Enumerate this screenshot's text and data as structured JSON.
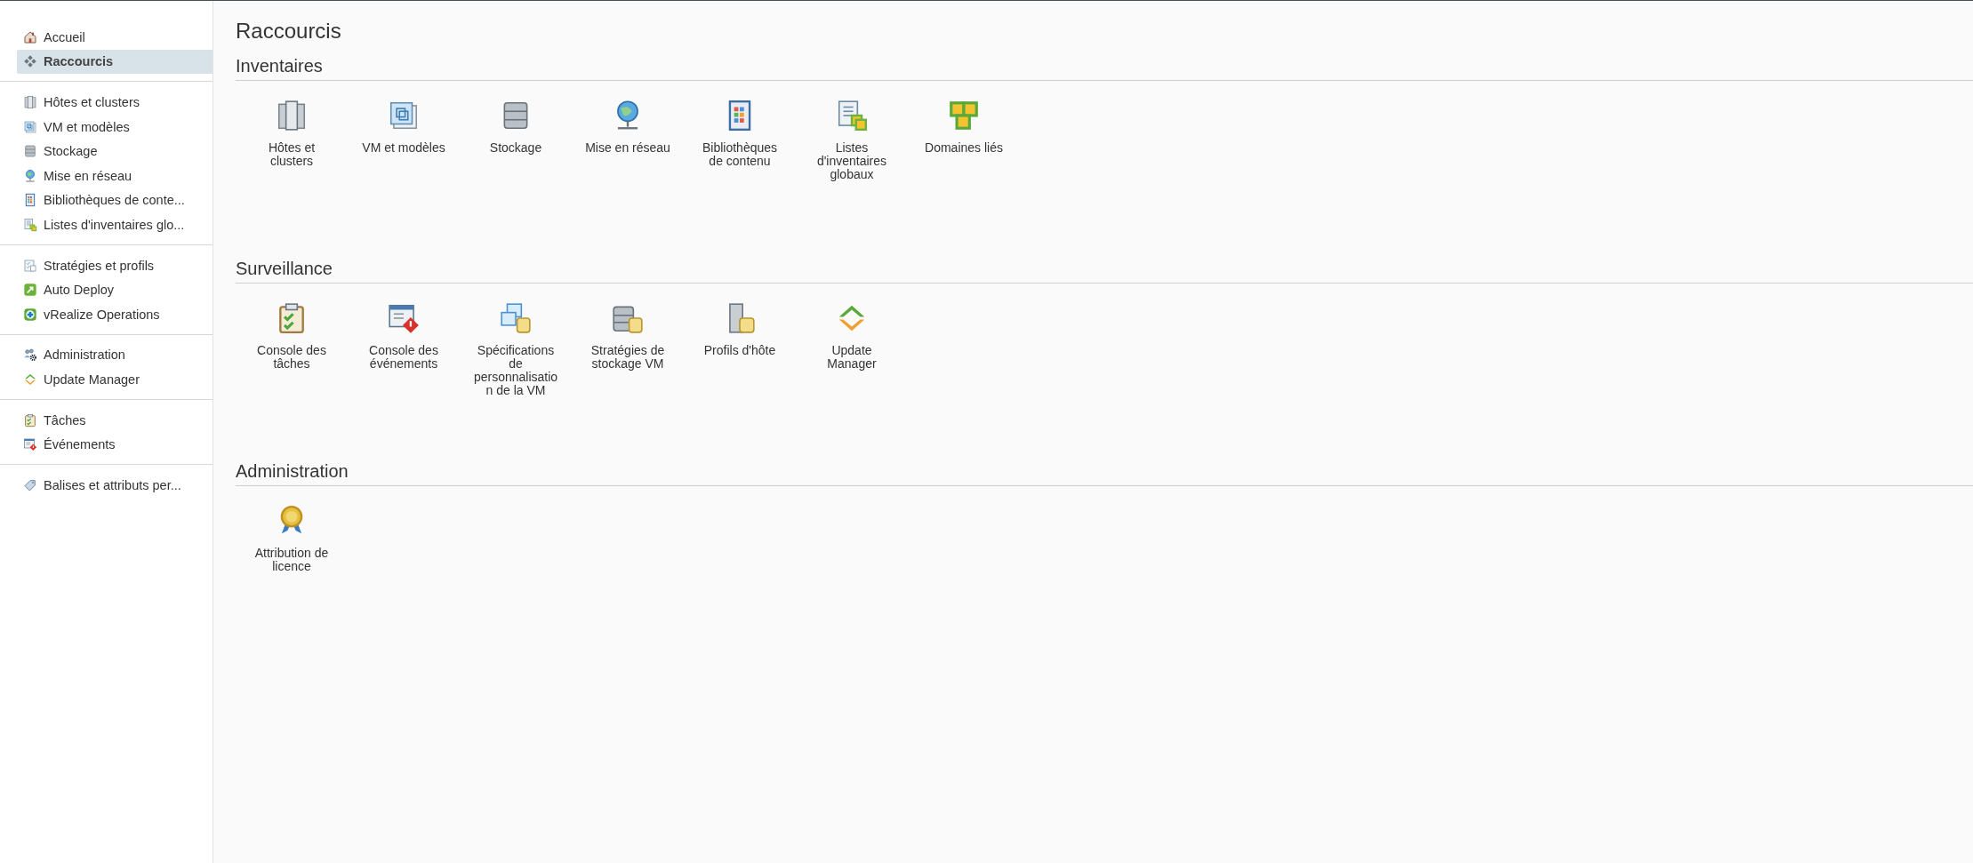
{
  "sidebar": {
    "groups": [
      [
        {
          "label": "Accueil",
          "kind": "home",
          "selected": false
        },
        {
          "label": "Raccourcis",
          "kind": "shortcuts",
          "selected": true
        }
      ],
      [
        {
          "label": "Hôtes et clusters",
          "kind": "hosts",
          "selected": false
        },
        {
          "label": "VM et modèles",
          "kind": "vms",
          "selected": false
        },
        {
          "label": "Stockage",
          "kind": "storage",
          "selected": false
        },
        {
          "label": "Mise en réseau",
          "kind": "network",
          "selected": false
        },
        {
          "label": "Bibliothèques de conte...",
          "kind": "library",
          "selected": false
        },
        {
          "label": "Listes d'inventaires glo...",
          "kind": "lists",
          "selected": false
        }
      ],
      [
        {
          "label": "Stratégies et profils",
          "kind": "policies",
          "selected": false
        },
        {
          "label": "Auto Deploy",
          "kind": "deploy",
          "selected": false
        },
        {
          "label": "vRealize Operations",
          "kind": "vrops",
          "selected": false
        }
      ],
      [
        {
          "label": "Administration",
          "kind": "admin",
          "selected": false
        },
        {
          "label": "Update Manager",
          "kind": "update",
          "selected": false
        }
      ],
      [
        {
          "label": "Tâches",
          "kind": "tasks",
          "selected": false
        },
        {
          "label": "Événements",
          "kind": "events",
          "selected": false
        }
      ],
      [
        {
          "label": "Balises et attributs per...",
          "kind": "tag",
          "selected": false
        }
      ]
    ]
  },
  "page": {
    "title": "Raccourcis",
    "sections": [
      {
        "heading": "Inventaires",
        "items": [
          {
            "label": "Hôtes et clusters",
            "kind": "hosts"
          },
          {
            "label": "VM et modèles",
            "kind": "vms"
          },
          {
            "label": "Stockage",
            "kind": "storage"
          },
          {
            "label": "Mise en réseau",
            "kind": "network"
          },
          {
            "label": "Bibliothèques de contenu",
            "kind": "library"
          },
          {
            "label": "Listes d'inventaires globaux",
            "kind": "lists"
          },
          {
            "label": "Domaines liés",
            "kind": "domains"
          }
        ]
      },
      {
        "heading": "Surveillance",
        "items": [
          {
            "label": "Console des tâches",
            "kind": "tasks"
          },
          {
            "label": "Console des événements",
            "kind": "events"
          },
          {
            "label": "Spécifications de personnalisation de la VM",
            "kind": "specs"
          },
          {
            "label": "Stratégies de stockage VM",
            "kind": "storagepol"
          },
          {
            "label": "Profils d'hôte",
            "kind": "hostprofile"
          },
          {
            "label": "Update Manager",
            "kind": "update"
          }
        ]
      },
      {
        "heading": "Administration",
        "items": [
          {
            "label": "Attribution de licence",
            "kind": "license"
          }
        ]
      }
    ]
  }
}
